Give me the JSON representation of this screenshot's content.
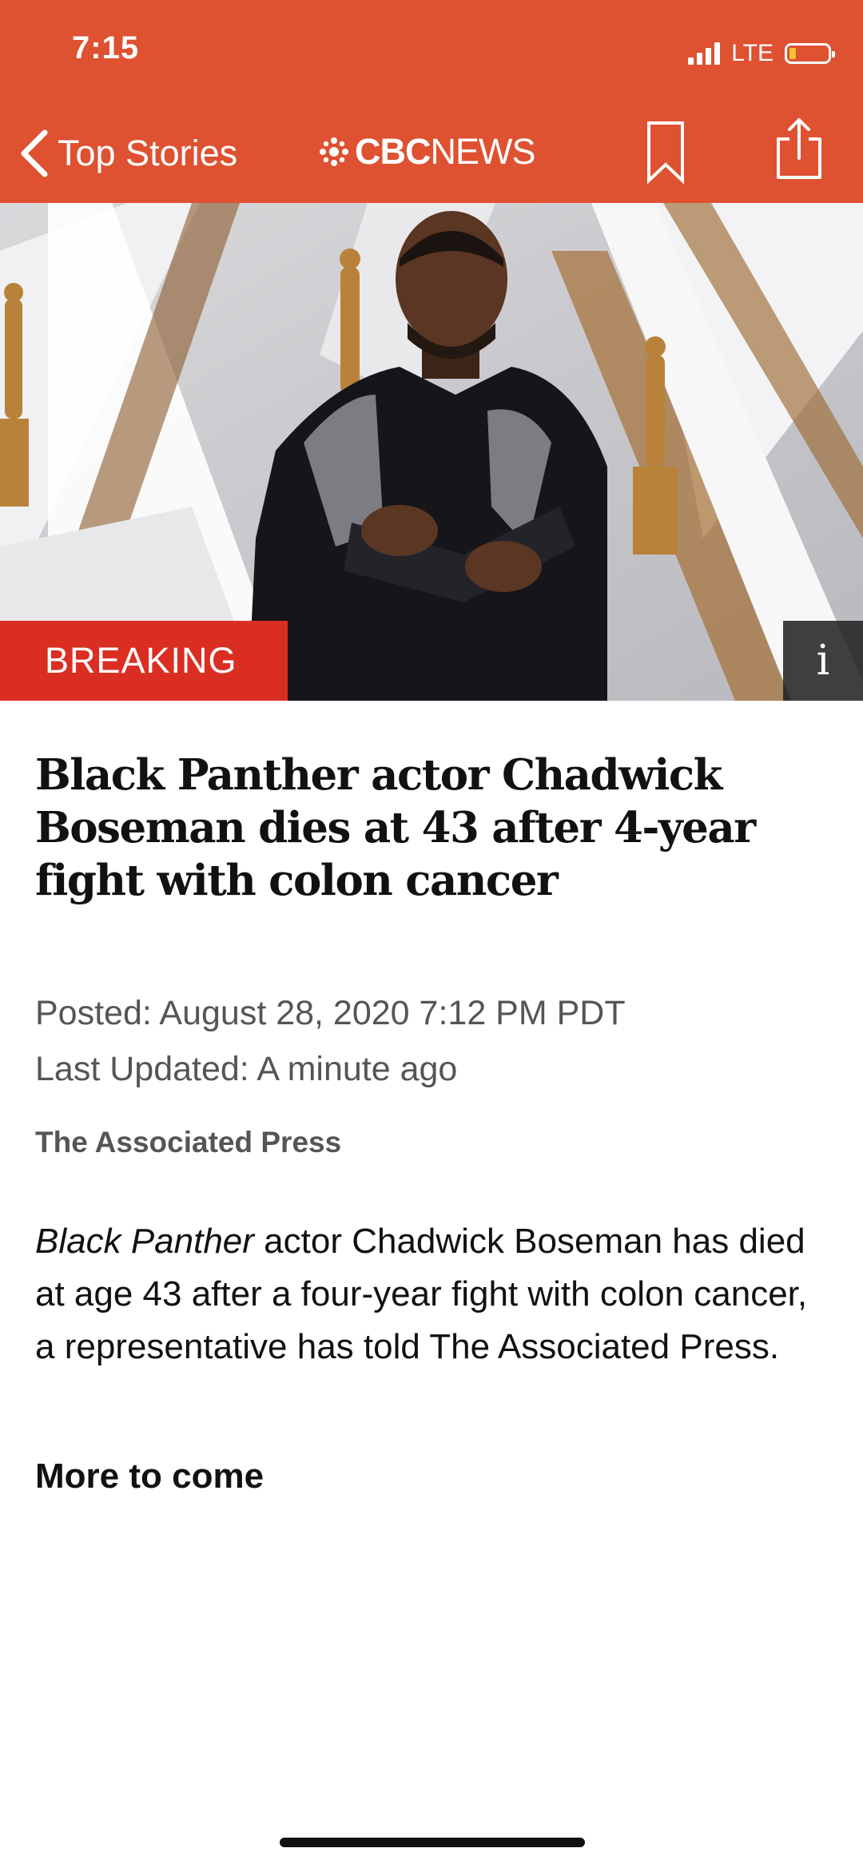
{
  "status_bar": {
    "time": "7:15",
    "network": "LTE"
  },
  "nav": {
    "back_label": "Top Stories",
    "logo_cbc": "CBC",
    "logo_news": "NEWS",
    "icons": {
      "back": "chevron-left-icon",
      "logo": "cbc-gem-logo",
      "bookmark": "bookmark-icon",
      "share": "share-icon"
    }
  },
  "hero": {
    "badge": "BREAKING",
    "info_label": "i"
  },
  "article": {
    "headline": "Black Panther actor Chadwick Boseman dies at 43 after 4-year fight with colon cancer",
    "posted": "Posted: August 28, 2020 7:12 PM PDT",
    "updated": "Last Updated: A minute ago",
    "byline": "The Associated Press",
    "body_italic": "Black Panther",
    "body_rest": " actor Chadwick Boseman has died at age 43 after a four-year fight with colon cancer, a representative has told The Associated Press.",
    "footer": "More to come"
  },
  "colors": {
    "header": "#DE5131",
    "breaking": "#DB2E22",
    "battery_low": "#F2C230"
  }
}
